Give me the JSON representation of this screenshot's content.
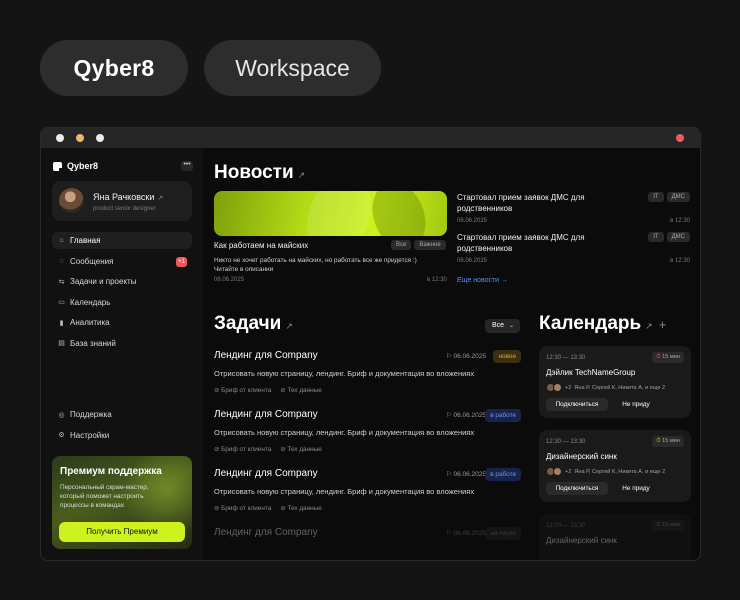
{
  "header": {
    "brand": "Qyber8",
    "workspace": "Workspace"
  },
  "sidebar": {
    "logo": "Qyber8",
    "more": "•••",
    "profile": {
      "name": "Яна Рачковски",
      "role": "product senior designer",
      "arrow": "↗"
    },
    "items": [
      {
        "label": "Главная",
        "icon": "home-icon",
        "glyph": "⌂"
      },
      {
        "label": "Сообщения",
        "icon": "message-icon",
        "glyph": "◌",
        "badge": "+1"
      },
      {
        "label": "Задачи и проекты",
        "icon": "tasks-icon",
        "glyph": "⇆"
      },
      {
        "label": "Календарь",
        "icon": "calendar-icon",
        "glyph": "▭"
      },
      {
        "label": "Аналитика",
        "icon": "chart-icon",
        "glyph": "▮"
      },
      {
        "label": "База знаний",
        "icon": "book-icon",
        "glyph": "▤"
      }
    ],
    "bottom": [
      {
        "label": "Поддержка",
        "icon": "support-icon",
        "glyph": "◎"
      },
      {
        "label": "Настройки",
        "icon": "settings-icon",
        "glyph": "⚙"
      }
    ],
    "premium": {
      "title": "Премиум поддержка",
      "text": "Персональный скрам-мастер, который поможет настроить процессы в командах",
      "button": "Получить Премиум"
    }
  },
  "news": {
    "title": "Новости",
    "arrow": "↗",
    "main": {
      "title": "Как работаем на майских",
      "tags": [
        "Все",
        "Важное"
      ],
      "desc": "Никто не хочет работать на майских, но работать все же придется :) Читайте в описании",
      "date": "06.06.2025",
      "time": "в 12:30"
    },
    "items": [
      {
        "title": "Стартовал прием заявок ДМС для родственников",
        "tags": [
          "IT",
          "ДМС"
        ],
        "date": "06.06.2025",
        "time": "в 12:30"
      },
      {
        "title": "Стартовал прием заявок ДМС для родственников",
        "tags": [
          "IT",
          "ДМС"
        ],
        "date": "06.06.2025",
        "time": "в 12:30"
      }
    ],
    "more": "Еще новости →"
  },
  "tasks": {
    "title": "Задачи",
    "arrow": "↗",
    "filter": "Все",
    "filter_chevron": "⌄",
    "items": [
      {
        "title": "Лендинг для Company",
        "date": "⚐ 06.06.2025",
        "status": "новое",
        "desc": "Отрисовать новую страницу, лендинг. Бриф и документация во вложениях",
        "link1": "⊘ Бриф от клиента",
        "link2": "⊘ Тех данные"
      },
      {
        "title": "Лендинг для Company",
        "date": "⚐ 06.06.2025",
        "status": "в работе",
        "desc": "Отрисовать новую страницу, лендинг. Бриф и документация во вложениях",
        "link1": "⊘ Бриф от клиента",
        "link2": "⊘ Тех данные"
      },
      {
        "title": "Лендинг для Company",
        "date": "⚐ 06.06.2025",
        "status": "в работе",
        "desc": "Отрисовать новую страницу, лендинг. Бриф и документация во вложениях",
        "link1": "⊘ Бриф от клиента",
        "link2": "⊘ Тех данные"
      },
      {
        "title": "Лендинг для Company",
        "date": "⚐ 06.06.2025",
        "status": "на паузе"
      }
    ]
  },
  "calendar": {
    "title": "Календарь",
    "arrow": "↗",
    "plus": "+",
    "events": [
      {
        "time": "12:30 — 13:30",
        "duration": "15 мин",
        "title": "Дэйлик TechNameGroup",
        "people": "Яна Р, Сергей К, Никита А. и еще 2",
        "count": "+2",
        "join": "Подключиться",
        "skip": "Не приду"
      },
      {
        "time": "12:30 — 13:30",
        "duration": "15 мин",
        "title": "Дизайнерский синк",
        "people": "Яна Р, Сергей К, Никита А. и еще 2",
        "count": "+2",
        "join": "Подключиться",
        "skip": "Не приду"
      },
      {
        "time": "12:30 — 13:30",
        "duration": "15 мин",
        "title": "Дизайнерский синк"
      }
    ]
  }
}
